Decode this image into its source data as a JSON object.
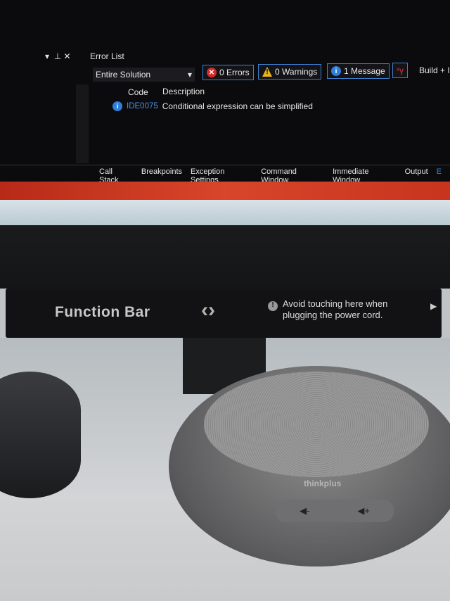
{
  "error_list": {
    "title": "Error List",
    "scope": "Entire Solution",
    "errors": "0 Errors",
    "warnings": "0 Warnings",
    "messages": "1 Message",
    "build_filter": "Build + I",
    "columns": [
      "Code",
      "Description"
    ],
    "rows": [
      {
        "code": "IDE0075",
        "description": "Conditional expression can be simplified"
      }
    ]
  },
  "bottom_tabs": [
    "Call Stack",
    "Breakpoints",
    "Exception Settings",
    "Command Window",
    "Immediate Window",
    "Output",
    "E"
  ],
  "function_bar": {
    "label": "Function Bar",
    "notice_line1": "Avoid touching here when",
    "notice_line2": "plugging the power cord."
  },
  "speaker": {
    "brand": "thinkplus"
  },
  "colors": {
    "accent": "#3d7fd0",
    "code_link": "#4a8fe0",
    "taskbar_red": "#c8341e"
  }
}
